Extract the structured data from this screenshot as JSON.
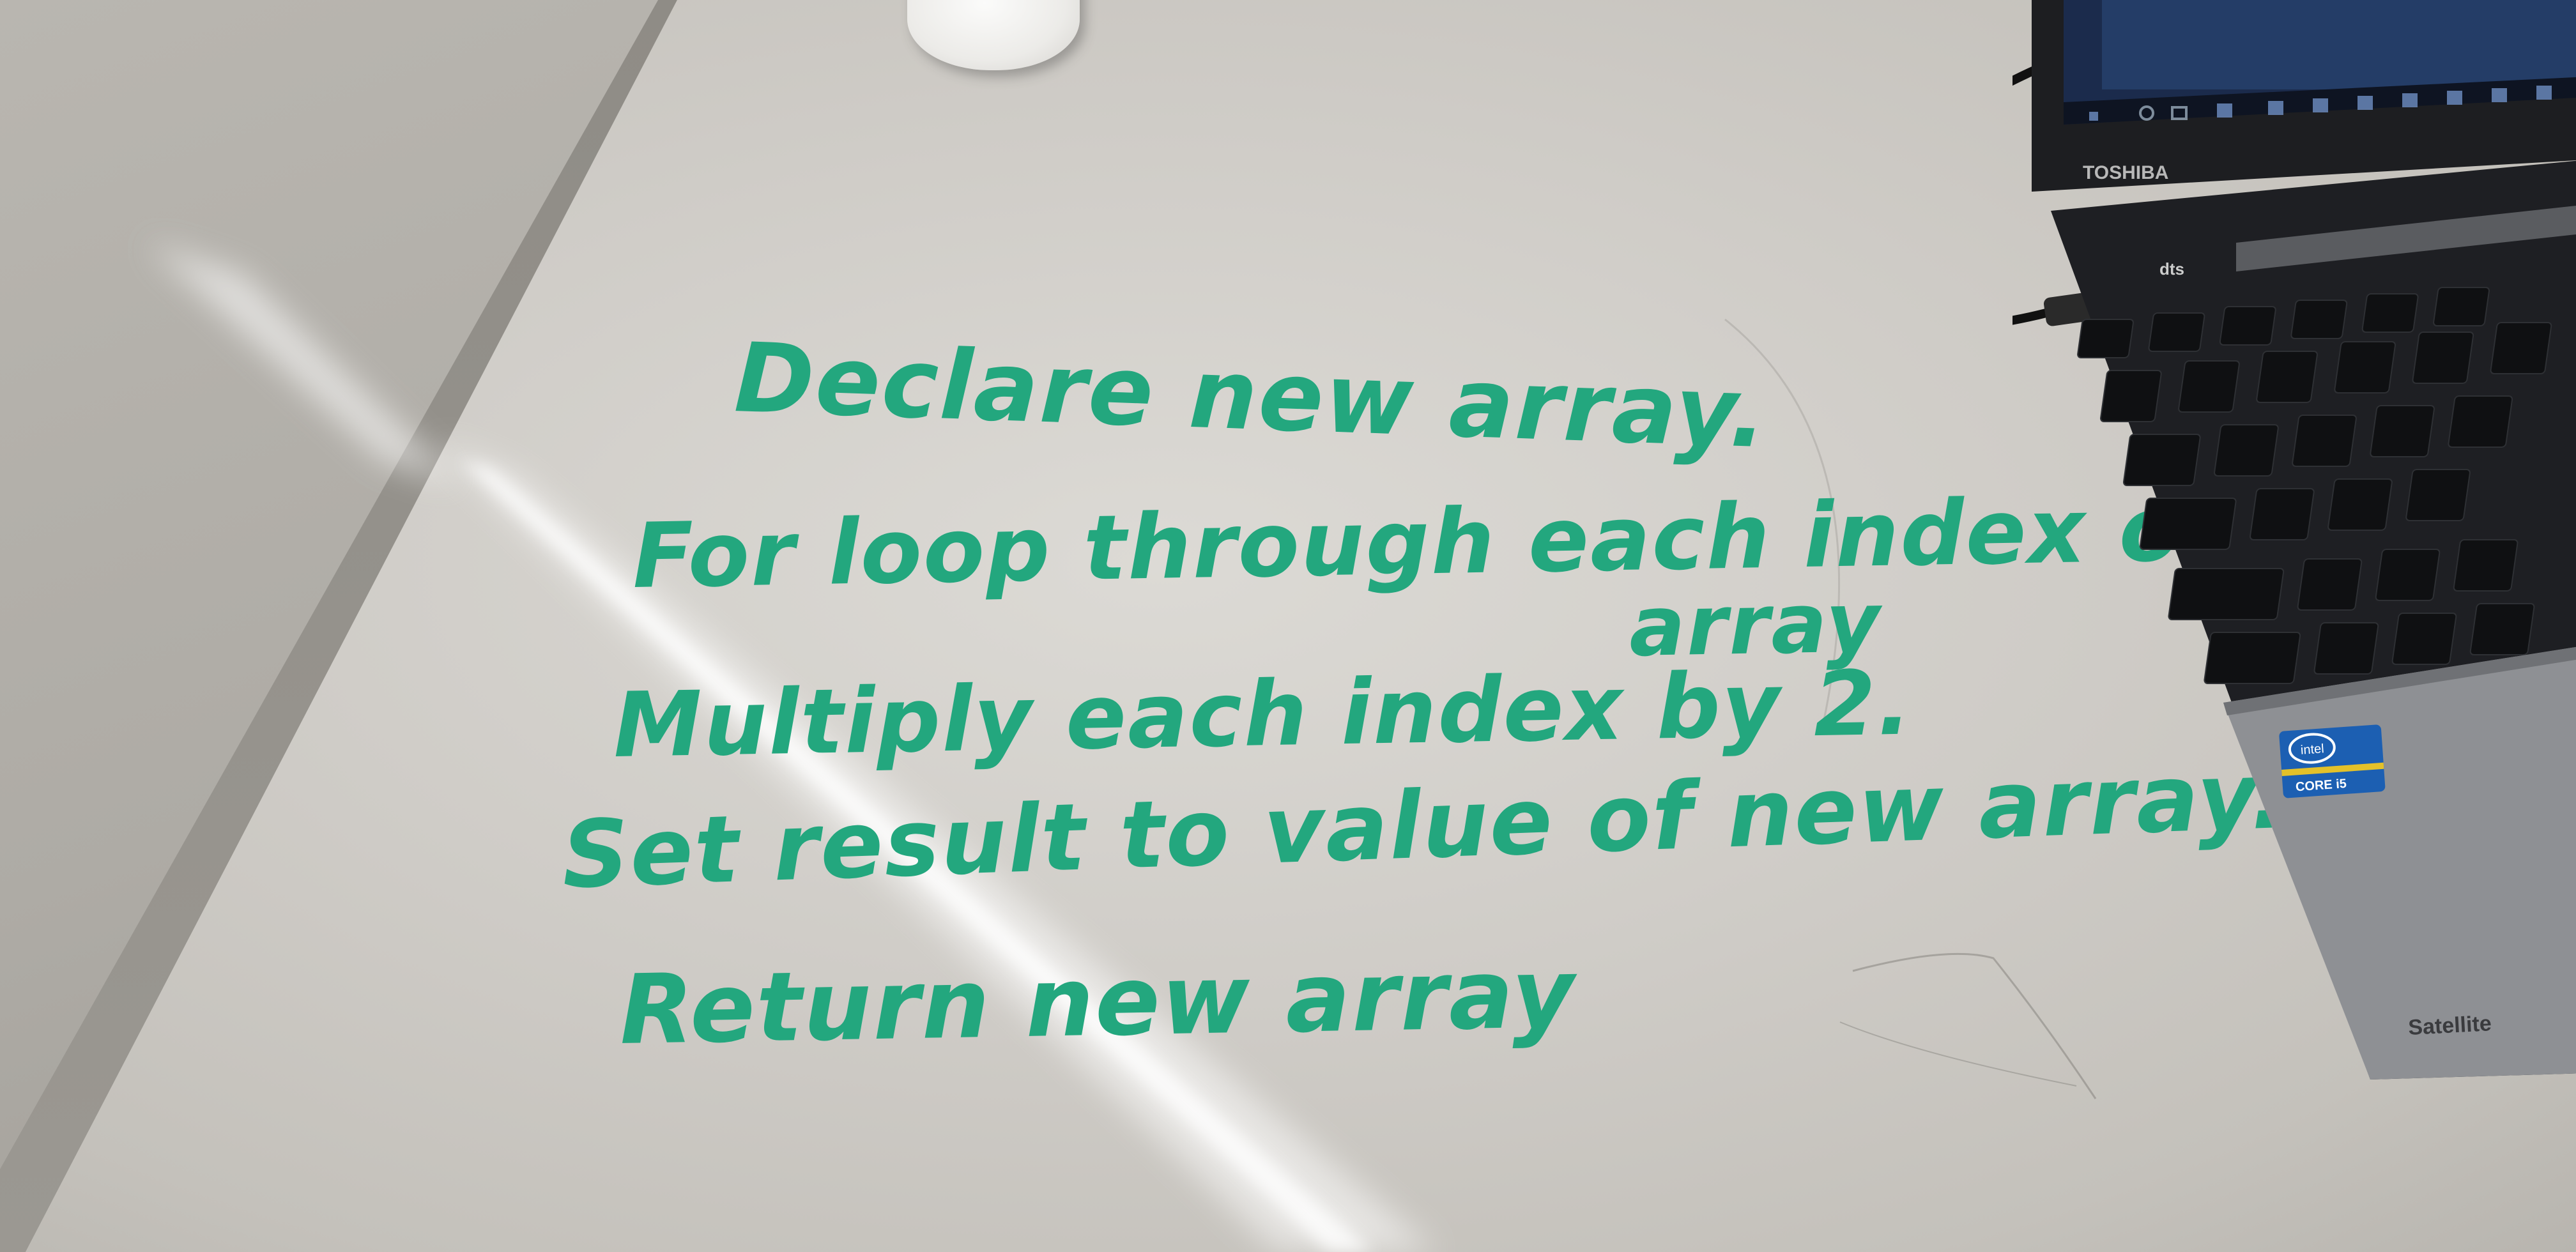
{
  "whiteboard": {
    "lines": [
      "Declare new array.",
      "For loop through each index of old",
      "array",
      "Multiply each index by 2.",
      "Set result to value of new array.",
      "Return new array"
    ]
  },
  "laptop": {
    "brand": "TOSHIBA",
    "model": "Satellite",
    "audio_badge": "dts",
    "sticker": "intel inside CORE i5",
    "colors": {
      "body": "#1d1e21",
      "palmrest": "#8e9094",
      "screen": "#1a2a4a"
    }
  },
  "colors": {
    "marker": "#23a77e",
    "board": "#d4d2cd"
  }
}
